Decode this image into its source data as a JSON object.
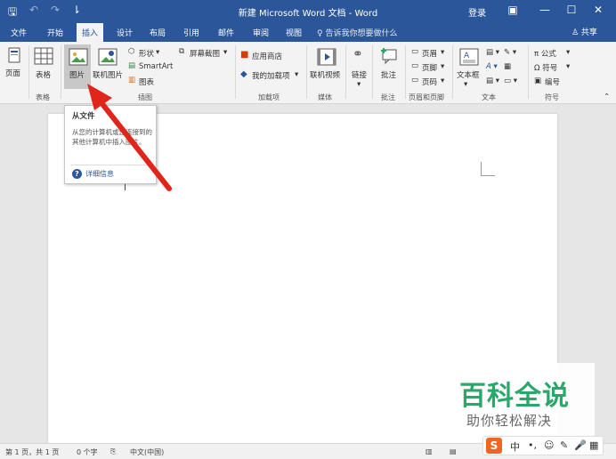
{
  "titlebar": {
    "save_glyph": "🖫",
    "undo_glyph": "↶",
    "redo_glyph": "↷",
    "customize_glyph": "⇂",
    "title": "新建 Microsoft Word 文档 - Word",
    "login": "登录",
    "ribbon_opts_glyph": "▣",
    "minimize_glyph": "—",
    "maximize_glyph": "☐",
    "close_glyph": "✕"
  },
  "tabs": {
    "items": [
      "文件",
      "开始",
      "插入",
      "设计",
      "布局",
      "引用",
      "邮件",
      "审阅",
      "视图"
    ],
    "active": "插入",
    "tellme": "♀ 告诉我你想要做什么",
    "share": "♙ 共享"
  },
  "ribbon": {
    "page_label": "页面",
    "table_label": "表格",
    "picture_label": "图片",
    "online_picture_label": "联机图片",
    "shapes_label": "形状",
    "screenshot_label": "屏幕截图",
    "smartart_label": "SmartArt",
    "chart_label": "图表",
    "store_label": "应用商店",
    "my_addins_label": "我的加载项",
    "online_video_label": "联机视频",
    "link_label": "链接",
    "comment_label": "批注",
    "header_label": "页眉",
    "footer_label": "页脚",
    "pagenum_label": "页码",
    "textbox_label": "文本框",
    "equation_label": "π 公式",
    "symbol_label": "Ω 符号",
    "numbering_label": "编号",
    "groups": {
      "tables": "表格",
      "illustrations": "插图",
      "addins": "加载项",
      "media": "媒体",
      "comments": "批注",
      "header_footer": "页眉和页脚",
      "text": "文本",
      "symbols": "符号"
    }
  },
  "tooltip": {
    "title": "从文件",
    "body": "从您的计算机或您连接到的其他计算机中插入图片。",
    "help": "详细信息"
  },
  "status": {
    "page": "第 1 页，共 1 页",
    "words": "0 个字",
    "lang": "中文(中国)"
  },
  "watermark": {
    "title": "百科全说",
    "subtitle": "助你轻松解决"
  },
  "ime": {
    "logo": "S",
    "items": [
      "中",
      "•,",
      "☺",
      "✎",
      "🎤",
      "▦"
    ]
  },
  "colors": {
    "brand": "#2b579a",
    "arrow": "#e0261b",
    "watermark": "#2aa86b"
  }
}
